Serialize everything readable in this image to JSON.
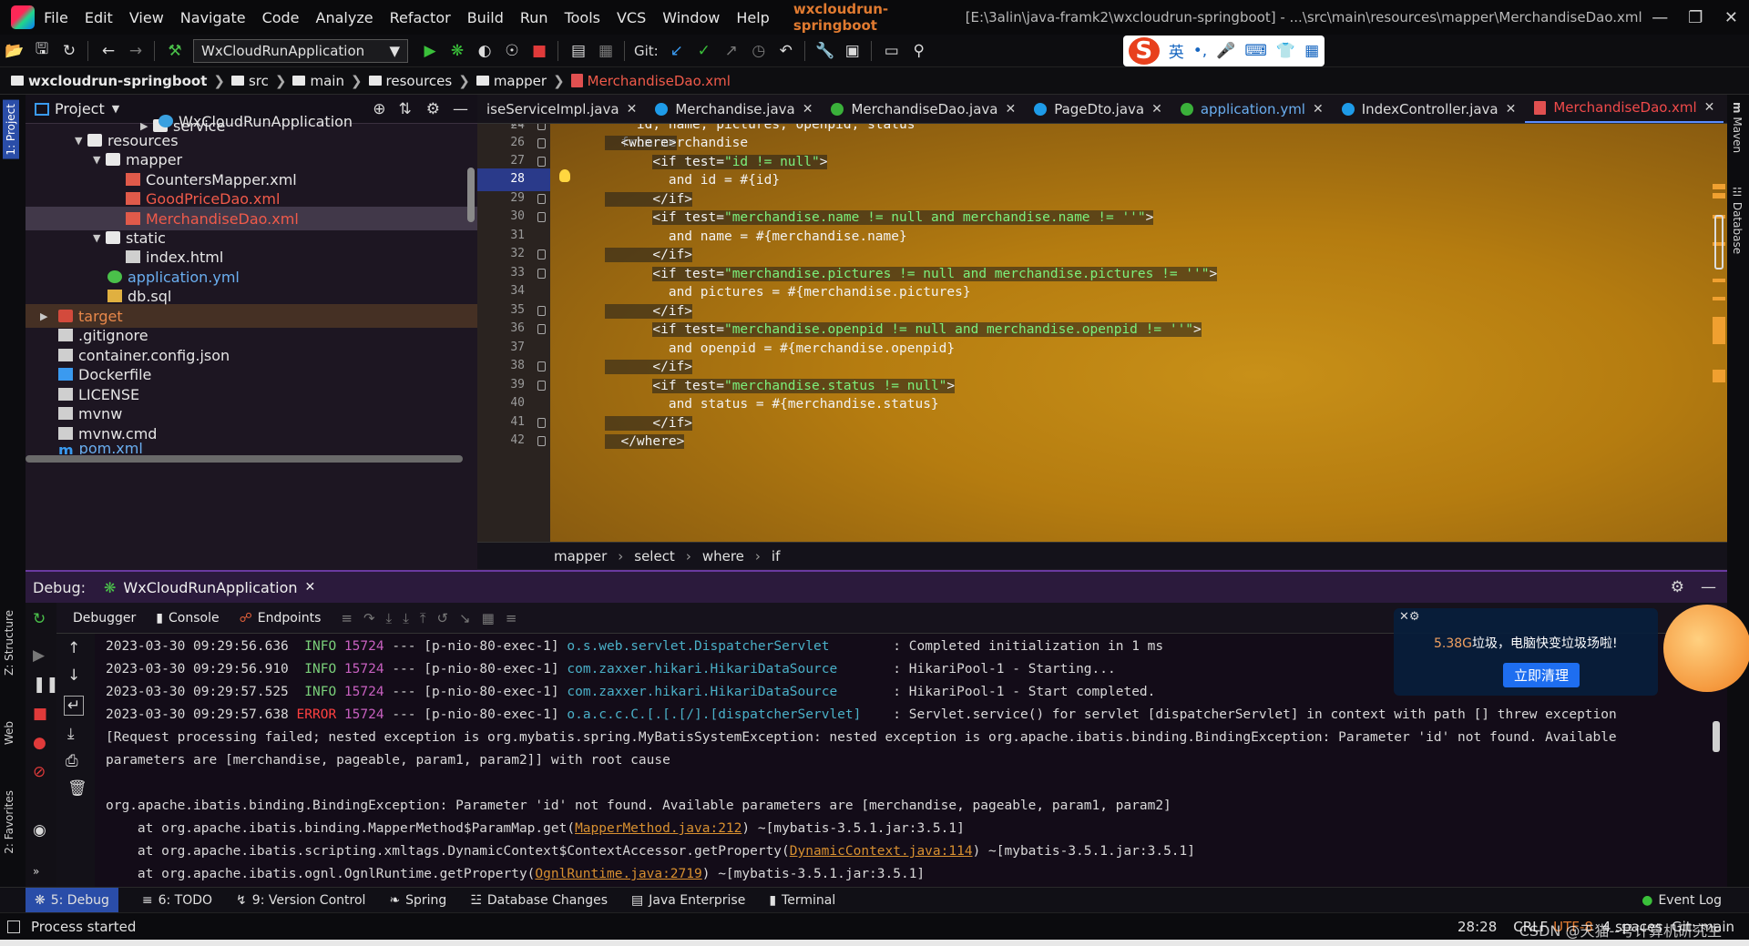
{
  "menubar": {
    "items": [
      "File",
      "Edit",
      "View",
      "Navigate",
      "Code",
      "Analyze",
      "Refactor",
      "Build",
      "Run",
      "Tools",
      "VCS",
      "Window",
      "Help"
    ],
    "project_title": "wxcloudrun-springboot",
    "path": "[E:\\3alin\\java-framk2\\wxcloudrun-springboot] - ...\\src\\main\\resources\\mapper\\MerchandiseDao.xml"
  },
  "toolbar": {
    "run_config": "WxCloudRunApplication",
    "git_label": "Git:",
    "ime": {
      "mode": "英",
      "punct": "•,"
    }
  },
  "breadcrumb": [
    "wxcloudrun-springboot",
    "src",
    "main",
    "resources",
    "mapper",
    "MerchandiseDao.xml"
  ],
  "left_strip": {
    "project_tab": "1: Project",
    "structure_tab": "Z: Structure",
    "web_tab": "Web",
    "favorites_tab": "2: Favorites"
  },
  "right_strip": {
    "maven_tab": "Maven",
    "database_tab": "Database"
  },
  "project_panel": {
    "title": "Project",
    "tree": [
      {
        "label": "service",
        "type": "folder",
        "depth": 5
      },
      {
        "label": "WxCloudRunApplication",
        "type": "java",
        "depth": 6
      },
      {
        "label": "resources",
        "type": "folder",
        "depth": 3,
        "expanded": true
      },
      {
        "label": "mapper",
        "type": "folder",
        "depth": 4,
        "expanded": true
      },
      {
        "label": "CountersMapper.xml",
        "type": "xml",
        "depth": 5
      },
      {
        "label": "GoodPriceDao.xml",
        "type": "xml-red",
        "depth": 5
      },
      {
        "label": "MerchandiseDao.xml",
        "type": "xml-red",
        "depth": 5,
        "selected": true
      },
      {
        "label": "static",
        "type": "folder",
        "depth": 4,
        "expanded": true
      },
      {
        "label": "index.html",
        "type": "html",
        "depth": 5
      },
      {
        "label": "application.yml",
        "type": "yml",
        "depth": 4
      },
      {
        "label": "db.sql",
        "type": "sql",
        "depth": 4
      },
      {
        "label": "target",
        "type": "folder-red",
        "depth": 1
      },
      {
        "label": ".gitignore",
        "type": "file",
        "depth": 1
      },
      {
        "label": "container.config.json",
        "type": "file",
        "depth": 1
      },
      {
        "label": "Dockerfile",
        "type": "file",
        "depth": 1
      },
      {
        "label": "LICENSE",
        "type": "file",
        "depth": 1
      },
      {
        "label": "mvnw",
        "type": "file",
        "depth": 1
      },
      {
        "label": "mvnw.cmd",
        "type": "file",
        "depth": 1
      },
      {
        "label": "pom.xml",
        "type": "pom",
        "depth": 1
      }
    ]
  },
  "editor_tabs": [
    {
      "label": "iseServiceImpl.java",
      "icon": "class"
    },
    {
      "label": "Merchandise.java",
      "icon": "class"
    },
    {
      "label": "MerchandiseDao.java",
      "icon": "interface"
    },
    {
      "label": "PageDto.java",
      "icon": "class"
    },
    {
      "label": "application.yml",
      "icon": "yml"
    },
    {
      "label": "IndexController.java",
      "icon": "class"
    },
    {
      "label": "MerchandiseDao.xml",
      "icon": "xml",
      "active": true
    }
  ],
  "tab_overflow": "3",
  "code": {
    "current_line": 28,
    "lines": [
      {
        "n": 24,
        "text": "    id, name, pictures, openpid, status"
      },
      {
        "n": 25,
        "text": "  from merchandise"
      },
      {
        "n": 26,
        "text": "  <where>"
      },
      {
        "n": 27,
        "pre": "      ",
        "tag_open": "<if test=",
        "val": "\"id != null\"",
        "tag_close": ">"
      },
      {
        "n": 28,
        "text": "        and id = #{id}"
      },
      {
        "n": 29,
        "text": "      </if>"
      },
      {
        "n": 30,
        "pre": "      ",
        "tag_open": "<if test=",
        "val": "\"merchandise.name != null and merchandise.name != ''\"",
        "tag_close": ">"
      },
      {
        "n": 31,
        "text": "        and name = #{merchandise.name}"
      },
      {
        "n": 32,
        "text": "      </if>"
      },
      {
        "n": 33,
        "pre": "      ",
        "tag_open": "<if test=",
        "val": "\"merchandise.pictures != null and merchandise.pictures != ''\"",
        "tag_close": ">"
      },
      {
        "n": 34,
        "text": "        and pictures = #{merchandise.pictures}"
      },
      {
        "n": 35,
        "text": "      </if>"
      },
      {
        "n": 36,
        "pre": "      ",
        "tag_open": "<if test=",
        "val": "\"merchandise.openpid != null and merchandise.openpid != ''\"",
        "tag_close": ">"
      },
      {
        "n": 37,
        "text": "        and openpid = #{merchandise.openpid}"
      },
      {
        "n": 38,
        "text": "      </if>"
      },
      {
        "n": 39,
        "pre": "      ",
        "tag_open": "<if test=",
        "val": "\"merchandise.status != null\"",
        "tag_close": ">"
      },
      {
        "n": 40,
        "text": "        and status = #{merchandise.status}"
      },
      {
        "n": 41,
        "text": "      </if>"
      },
      {
        "n": 42,
        "text": "  </where>"
      }
    ]
  },
  "code_breadcrumb": [
    "mapper",
    "select",
    "where",
    "if"
  ],
  "debug": {
    "label": "Debug:",
    "session": "WxCloudRunApplication",
    "tabs": [
      "Debugger",
      "Console",
      "Endpoints"
    ],
    "console": [
      {
        "ts": "2023-03-30 09:29:56.636",
        "level": "INFO",
        "pid": "15724",
        "thread": "--- [p-nio-80-exec-1]",
        "logger": "o.s.web.servlet.DispatcherServlet",
        "msg": "        : Completed initialization in 1 ms"
      },
      {
        "ts": "2023-03-30 09:29:56.910",
        "level": "INFO",
        "pid": "15724",
        "thread": "--- [p-nio-80-exec-1]",
        "logger": "com.zaxxer.hikari.HikariDataSource",
        "msg": "       : HikariPool-1 - Starting..."
      },
      {
        "ts": "2023-03-30 09:29:57.525",
        "level": "INFO",
        "pid": "15724",
        "thread": "--- [p-nio-80-exec-1]",
        "logger": "com.zaxxer.hikari.HikariDataSource",
        "msg": "       : HikariPool-1 - Start completed."
      },
      {
        "ts": "2023-03-30 09:29:57.638",
        "level": "ERROR",
        "pid": "15724",
        "thread": "--- [p-nio-80-exec-1]",
        "logger": "o.a.c.c.C.[.[.[/].[dispatcherServlet]",
        "msg": "    : Servlet.service() for servlet [dispatcherServlet] in context with path [] threw exception"
      }
    ],
    "wrap1": "[Request processing failed; nested exception is org.mybatis.spring.MyBatisSystemException: nested exception is org.apache.ibatis.binding.BindingException: Parameter 'id' not found. Available",
    "wrap2": "parameters are [merchandise, pageable, param1, param2]] with root cause",
    "exception": "org.apache.ibatis.binding.BindingException: Parameter 'id' not found. Available parameters are [merchandise, pageable, param1, param2]",
    "stack": [
      {
        "pre": "    at org.apache.ibatis.binding.MapperMethod$ParamMap.get(",
        "link": "MapperMethod.java:212",
        "post": ") ~[mybatis-3.5.1.jar:3.5.1]"
      },
      {
        "pre": "    at org.apache.ibatis.scripting.xmltags.DynamicContext$ContextAccessor.getProperty(",
        "link": "DynamicContext.java:114",
        "post": ") ~[mybatis-3.5.1.jar:3.5.1]"
      },
      {
        "pre": "    at org.apache.ibatis.ognl.OgnlRuntime.getProperty(",
        "link": "OgnlRuntime.java:2719",
        "post": ") ~[mybatis-3.5.1.jar:3.5.1]"
      }
    ]
  },
  "popup": {
    "size_text": "5.38G",
    "message": "垃圾，电脑快变垃圾场啦!",
    "button": "立即清理"
  },
  "bottom_tabs": [
    "5: Debug",
    "6: TODO",
    "9: Version Control",
    "Spring",
    "Database Changes",
    "Java Enterprise",
    "Terminal"
  ],
  "event_log": "Event Log",
  "status": {
    "message": "Process started",
    "position": "28:28",
    "line_sep": "CRLF",
    "encoding": "UTF-8",
    "indent": "4 spaces",
    "git": "Git: main",
    "watermark": "CSDN @天猫--号计算机研究生"
  },
  "colors": {
    "accent": "#2a4da8",
    "debug_header": "#2b1a3c",
    "error": "#ff4040",
    "info": "#7ad07a",
    "code_bg": "#b57c10"
  }
}
